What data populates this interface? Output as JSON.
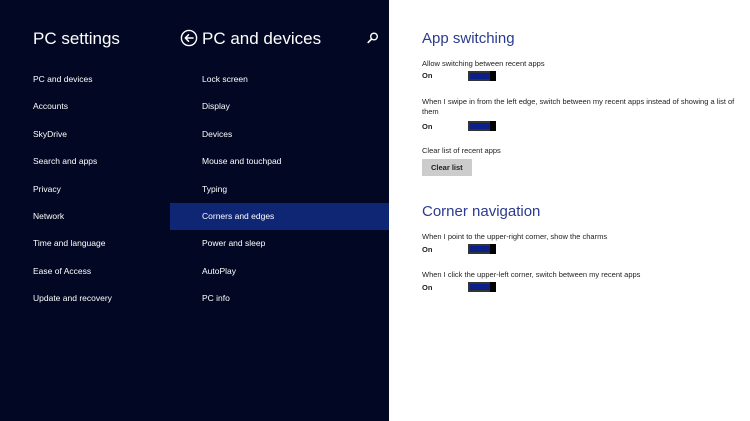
{
  "left_panel": {
    "title": "PC settings",
    "items": [
      {
        "label": "PC and devices"
      },
      {
        "label": "Accounts"
      },
      {
        "label": "SkyDrive"
      },
      {
        "label": "Search and apps"
      },
      {
        "label": "Privacy"
      },
      {
        "label": "Network"
      },
      {
        "label": "Time and language"
      },
      {
        "label": "Ease of Access"
      },
      {
        "label": "Update and recovery"
      }
    ]
  },
  "middle_panel": {
    "title": "PC and devices",
    "back_icon": "back-arrow-circle-icon",
    "search_icon": "search-icon",
    "selected": "Corners and edges",
    "items": [
      {
        "label": "Lock screen"
      },
      {
        "label": "Display"
      },
      {
        "label": "Devices"
      },
      {
        "label": "Mouse and touchpad"
      },
      {
        "label": "Typing"
      },
      {
        "label": "Corners and edges"
      },
      {
        "label": "Power and sleep"
      },
      {
        "label": "AutoPlay"
      },
      {
        "label": "PC info"
      }
    ]
  },
  "content": {
    "app_switching": {
      "title": "App switching",
      "allow_switching": {
        "label": "Allow switching between recent apps",
        "state": "On"
      },
      "swipe_left_edge": {
        "label": "When I swipe in from the left edge, switch between my recent apps instead of showing a list of them",
        "state": "On"
      },
      "clear_list": {
        "label": "Clear list of recent apps",
        "button": "Clear list"
      }
    },
    "corner_navigation": {
      "title": "Corner navigation",
      "upper_right": {
        "label": "When I point to the upper-right corner, show the charms",
        "state": "On"
      },
      "upper_left": {
        "label": "When I click the upper-left corner, switch between my recent apps",
        "state": "On"
      }
    }
  },
  "colors": {
    "panel_background": "#020823",
    "selected_item": "#0f2675",
    "section_title": "#2a3b8f",
    "toggle_fill": "#0a1f8a"
  }
}
